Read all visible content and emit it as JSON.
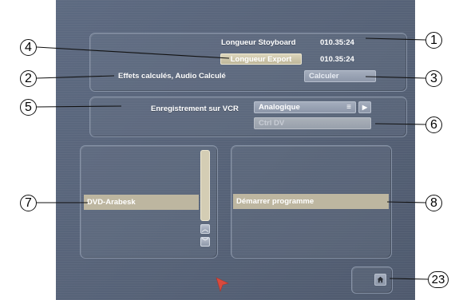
{
  "top_panel": {
    "storyboard_label": "Longueur Stoyboard",
    "storyboard_value": "010.35:24",
    "export_button": "Longueur Export",
    "export_value": "010.35:24",
    "effects_text": "Effets calculés, Audio Calculé",
    "calculate_button": "Calculer"
  },
  "vcr_panel": {
    "record_label": "Enregistrement sur VCR",
    "select_value": "Analogique",
    "ctrl_dv_button": "Ctrl DV"
  },
  "left_panel": {
    "items": [
      "DVD-Arabesk"
    ]
  },
  "right_panel": {
    "start_button": "Démarrer programme"
  },
  "callouts": {
    "c1": "1",
    "c2": "2",
    "c3": "3",
    "c4": "4",
    "c5": "5",
    "c6": "6",
    "c7": "7",
    "c8": "8",
    "c23": "23"
  },
  "icons": {
    "menu": "menu-icon",
    "play": "play-icon",
    "scroll_up": "chevron-up-icon",
    "scroll_down": "chevron-down-icon",
    "home": "home-icon",
    "cursor": "cursor-arrow-icon"
  },
  "colors": {
    "background": "#5a6679",
    "button_tan": "#c9c1a5",
    "selection": "#bdb6a0",
    "cursor": "#d94a3d"
  }
}
